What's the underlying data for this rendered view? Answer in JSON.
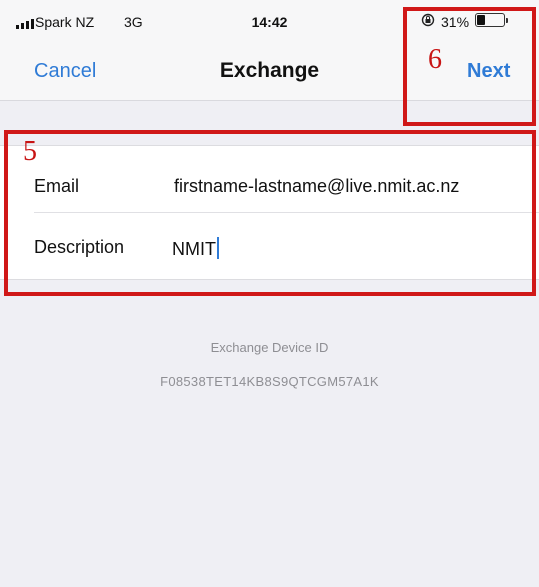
{
  "status_bar": {
    "carrier": "Spark NZ",
    "network": "3G",
    "time": "14:42",
    "battery_percent": "31%",
    "battery_level": 0.31
  },
  "nav": {
    "cancel_label": "Cancel",
    "title": "Exchange",
    "next_label": "Next"
  },
  "form": {
    "email": {
      "label": "Email",
      "value": "firstname-lastname@live.nmit.ac.nz"
    },
    "description": {
      "label": "Description",
      "value": "NMIT"
    }
  },
  "device": {
    "label": "Exchange Device ID",
    "id": "F08538TET14KB8S9QTCGM57A1K"
  },
  "annotations": {
    "step_form": "5",
    "step_next": "6",
    "color": "#d01818"
  },
  "colors": {
    "accent": "#2f7bd6",
    "background": "#efeff4"
  }
}
